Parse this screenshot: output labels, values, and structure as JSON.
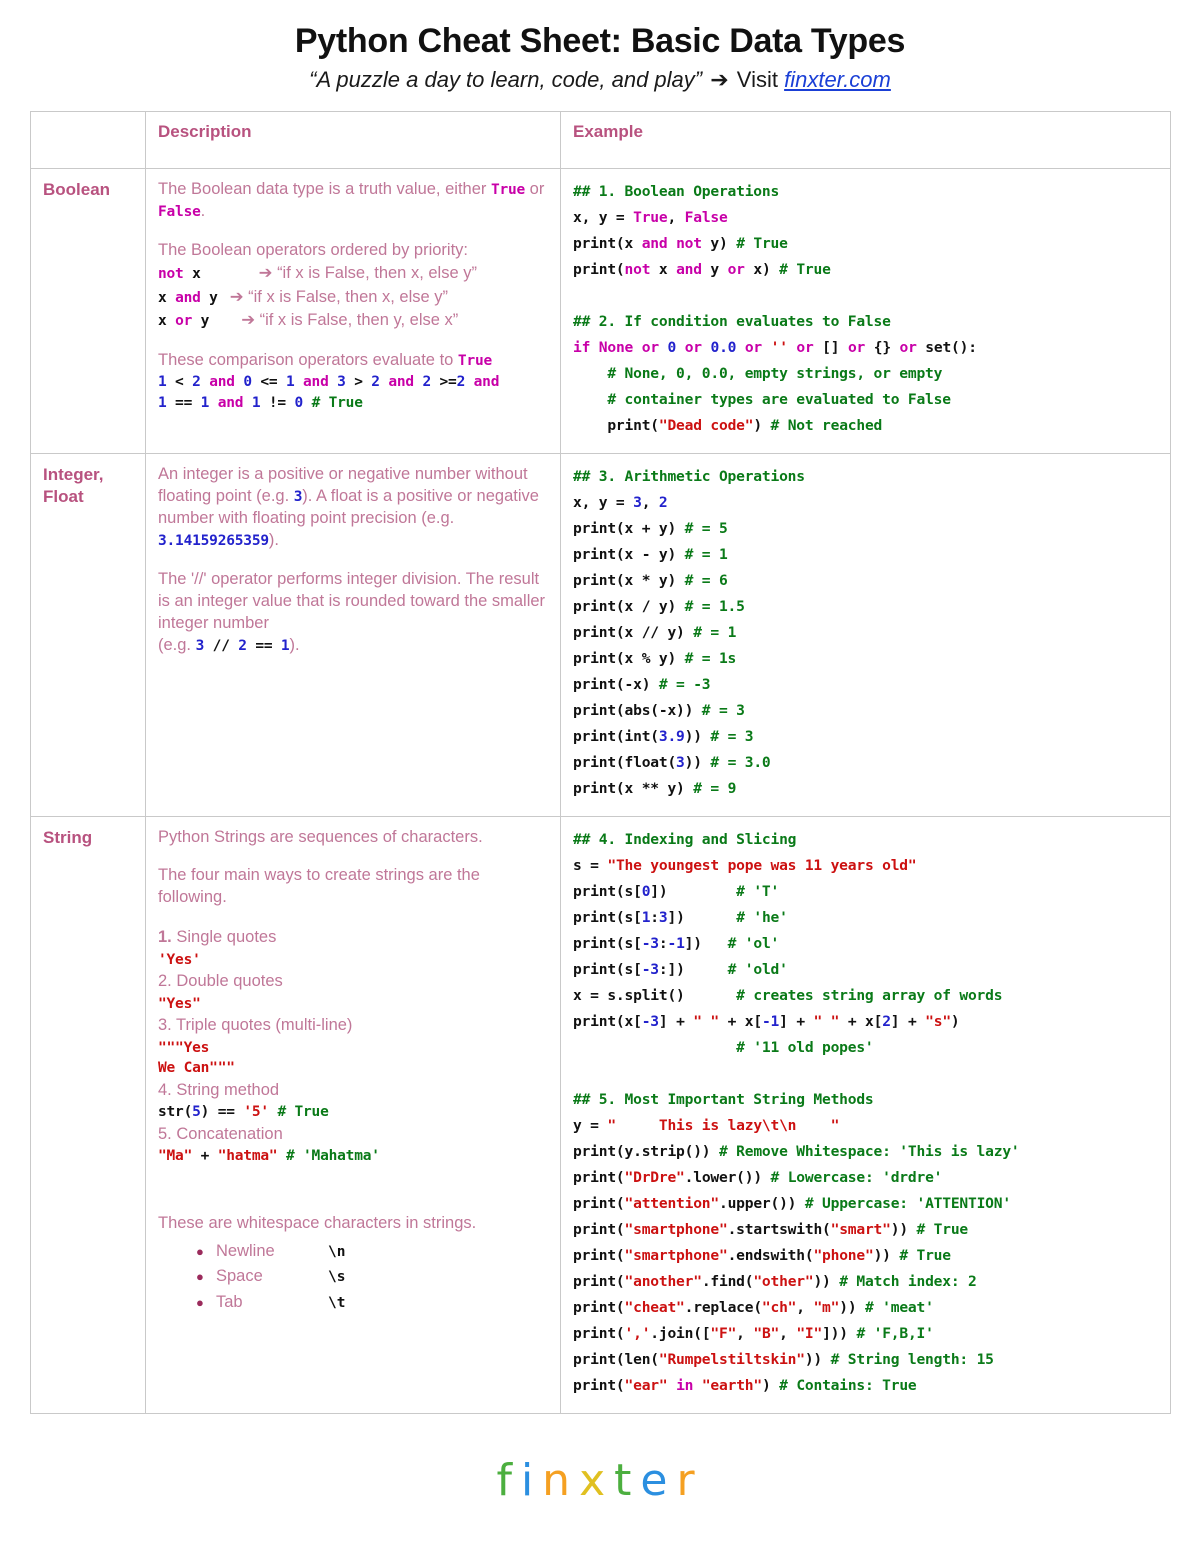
{
  "header": {
    "title": "Python Cheat Sheet: Basic Data Types",
    "subtitle_quote": "“A puzzle a day to learn, code, and play”",
    "subtitle_arrow": "➔",
    "subtitle_visit": "Visit",
    "subtitle_link": "finxter.com"
  },
  "table": {
    "headers": {
      "type": "",
      "description": "Description",
      "example": "Example"
    },
    "rows": [
      {
        "type": "Boolean",
        "description": {
          "p1_a": "The Boolean data type is a truth value, either ",
          "p1_true": "True",
          "p1_or": " or ",
          "p1_false": "False",
          "p1_end": ".",
          "p2_intro": "The Boolean operators ordered by priority:",
          "op1_code": "not x",
          "op1_desc": "➔ “if x is False, then x, else y”",
          "op2_code": "x and y",
          "op2_desc": "➔ “if x is False, then x, else y”",
          "op3_code": "x or y",
          "op3_desc": "➔ “if x is False, then y, else x”",
          "p3_intro": "These comparison operators evaluate to ",
          "p3_true": "True",
          "cmp_line1": "1 < 2 and 0 <= 1 and 3 > 2 and 2 >=2 and",
          "cmp_line2": "1 == 1 and 1 != 0 # True"
        },
        "example_title": "## 1. Boolean Operations",
        "example_code": [
          "## 1. Boolean Operations",
          "x, y = True, False",
          "print(x and not y) # True",
          "print(not x and y or x) # True",
          "",
          "## 2. If condition evaluates to False",
          "if None or 0 or 0.0 or '' or [] or {} or set():",
          "    # None, 0, 0.0, empty strings, or empty",
          "    # container types are evaluated to False",
          "    print(\"Dead code\") # Not reached"
        ]
      },
      {
        "type": "Integer, Float",
        "description": {
          "p1_a": "An integer is a positive or negative number without floating point (e.g. ",
          "p1_three": "3",
          "p1_b": "). A float is a positive or negative number with floating point precision (e.g. ",
          "p1_pi": "3.14159265359",
          "p1_c": ").",
          "p2_a": "The '//' operator performs integer division. The result is an integer value that is rounded toward the smaller integer number",
          "p2_b": "(e.g. ",
          "p2_expr_3": "3",
          "p2_expr_div": " // ",
          "p2_expr_2": "2",
          "p2_expr_eq": " == ",
          "p2_expr_1": "1",
          "p2_c": ")."
        },
        "example_code": [
          "## 3. Arithmetic Operations",
          "x, y = 3, 2",
          "print(x + y) # = 5",
          "print(x - y) # = 1",
          "print(x * y) # = 6",
          "print(x / y) # = 1.5",
          "print(x // y) # = 1",
          "print(x % y) # = 1s",
          "print(-x) # = -3",
          "print(abs(-x)) # = 3",
          "print(int(3.9)) # = 3",
          "print(float(3)) # = 3.0",
          "print(x ** y) # = 9"
        ]
      },
      {
        "type": "String",
        "description": {
          "p1": "Python Strings are sequences of characters.",
          "p2": "The four main ways to create strings are the following.",
          "items": [
            {
              "num": "1.",
              "label": " Single quotes",
              "code": "'Yes'"
            },
            {
              "num": "2.",
              "label": " Double quotes",
              "code": "\"Yes\""
            },
            {
              "num": "3.",
              "label": " Triple quotes (multi-line)",
              "code": "\"\"\"Yes",
              "code2": "We Can\"\"\""
            },
            {
              "num": "4.",
              "label": " String method",
              "code": "str(5) == '5' # True"
            },
            {
              "num": "5.",
              "label": " Concatenation",
              "code": "\"Ma\" + \"hatma\" # 'Mahatma'"
            }
          ],
          "p3": "These are whitespace characters in strings.",
          "whitespace": [
            {
              "name": "Newline",
              "code": "\\n"
            },
            {
              "name": "Space",
              "code": "\\s"
            },
            {
              "name": "Tab",
              "code": "\\t"
            }
          ]
        },
        "example_code": [
          "## 4. Indexing and Slicing",
          "s = \"The youngest pope was 11 years old\"",
          "print(s[0])        # 'T'",
          "print(s[1:3])      # 'he'",
          "print(s[-3:-1])    # 'ol'",
          "print(s[-3:])      # 'old'",
          "x = s.split()      # creates string array of words",
          "print(x[-3] + \" \" + x[-1] + \" \" + x[2] + \"s\")",
          "                   # '11 old popes'",
          "",
          "## 5. Most Important String Methods",
          "y = \"     This is lazy\\t\\n    \"",
          "print(y.strip()) # Remove Whitespace: 'This is lazy'",
          "print(\"DrDre\".lower()) # Lowercase: 'drdre'",
          "print(\"attention\".upper()) # Uppercase: 'ATTENTION'",
          "print(\"smartphone\".startswith(\"smart\")) # True",
          "print(\"smartphone\".endswith(\"phone\")) # True",
          "print(\"another\".find(\"other\")) # Match index: 2",
          "print(\"cheat\".replace(\"ch\", \"m\")) # 'meat'",
          "print(',' .join([\"F\", \"B\", \"I\"])) # 'F,B,I'",
          "print(len(\"Rumpelstiltskin\")) # String length: 15",
          "print(\"ear\" in \"earth\") # Contains: True"
        ]
      }
    ]
  },
  "footer": {
    "logo_letters": [
      {
        "ch": "f",
        "color": "#4caf3f"
      },
      {
        "ch": "i",
        "color": "#2b8fe0"
      },
      {
        "ch": "n",
        "color": "#f5a021"
      },
      {
        "ch": "x",
        "color": "#e0c021"
      },
      {
        "ch": "t",
        "color": "#4caf3f"
      },
      {
        "ch": "e",
        "color": "#2b8fe0"
      },
      {
        "ch": "r",
        "color": "#f5a021"
      }
    ]
  },
  "colors": {
    "heading_pink": "#b8527f",
    "body_pink": "#c07798",
    "keyword": "#c800a8",
    "number": "#2222cc",
    "string": "#cc1111",
    "comment": "#0a7a18",
    "link": "#1a3fd6"
  }
}
